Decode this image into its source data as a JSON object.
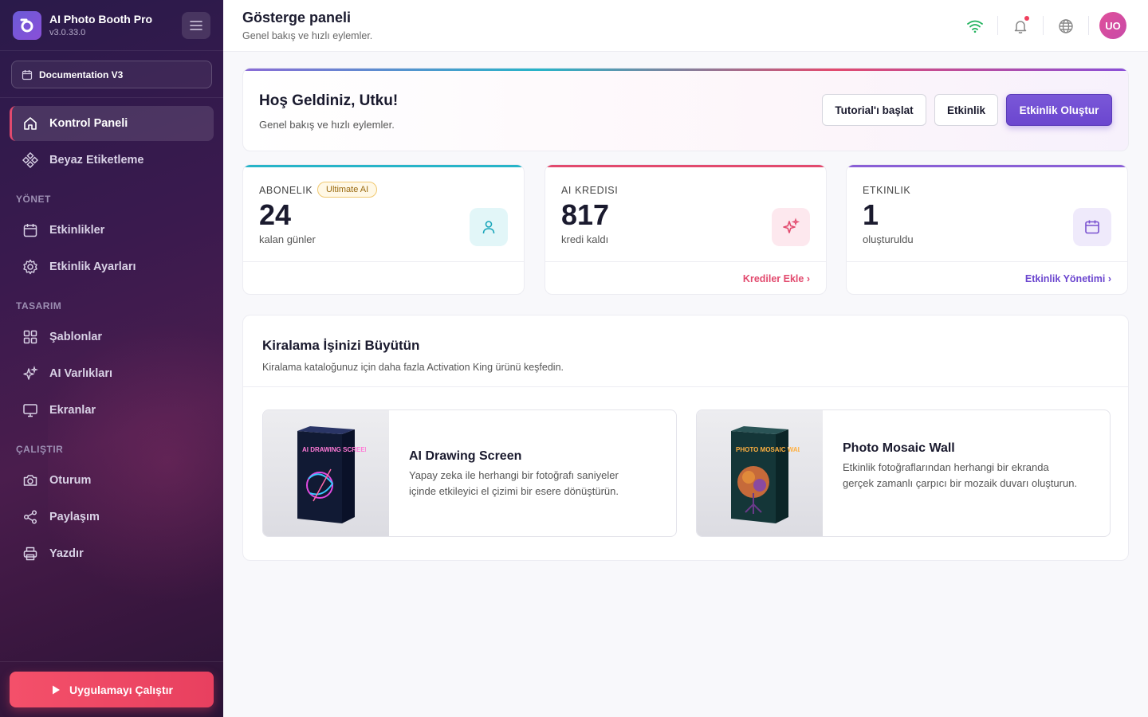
{
  "app": {
    "title": "AI Photo Booth Pro",
    "version": "v3.0.33.0"
  },
  "sidebar": {
    "doc_select": "Documentation V3",
    "items_main": [
      {
        "label": "Kontrol Paneli",
        "icon": "home-icon",
        "active": true
      },
      {
        "label": "Beyaz Etiketleme",
        "icon": "diamond-grid-icon"
      }
    ],
    "section_manage": "YÖNET",
    "items_manage": [
      {
        "label": "Etkinlikler",
        "icon": "calendar-icon"
      },
      {
        "label": "Etkinlik Ayarları",
        "icon": "gear-icon"
      }
    ],
    "section_design": "TASARIM",
    "items_design": [
      {
        "label": "Şablonlar",
        "icon": "grid-icon"
      },
      {
        "label": "AI Varlıkları",
        "icon": "sparkles-icon"
      },
      {
        "label": "Ekranlar",
        "icon": "monitor-icon"
      }
    ],
    "section_run": "ÇALIŞTIR",
    "items_run": [
      {
        "label": "Oturum",
        "icon": "camera-icon"
      },
      {
        "label": "Paylaşım",
        "icon": "share-icon"
      },
      {
        "label": "Yazdır",
        "icon": "printer-icon"
      }
    ],
    "run_button": "Uygulamayı Çalıştır"
  },
  "header": {
    "title": "Gösterge paneli",
    "subtitle": "Genel bakış ve hızlı eylemler.",
    "avatar_initials": "UO"
  },
  "welcome": {
    "title": "Hoş Geldiniz, Utku!",
    "subtitle": "Genel bakış ve hızlı eylemler.",
    "btn_tutorial": "Tutorial'ı başlat",
    "btn_event": "Etkinlik",
    "btn_create": "Etkinlik Oluştur"
  },
  "stats": {
    "subscription": {
      "label": "ABONELIK",
      "badge": "Ultimate AI",
      "value": "24",
      "sub": "kalan günler"
    },
    "credits": {
      "label": "AI KREDISI",
      "value": "817",
      "sub": "kredi kaldı",
      "link": "Krediler Ekle ›"
    },
    "events": {
      "label": "ETKINLIK",
      "value": "1",
      "sub": "oluşturuldu",
      "link": "Etkinlik Yönetimi ›"
    }
  },
  "grow": {
    "title": "Kiralama İşinizi Büyütün",
    "subtitle": "Kiralama kataloğunuz için daha fazla Activation King ürünü keşfedin.",
    "products": [
      {
        "name": "AI Drawing Screen",
        "box_label": "AI DRAWING SCREEN",
        "desc": "Yapay zeka ile herhangi bir fotoğrafı saniyeler içinde etkileyici el çizimi bir esere dönüştürün."
      },
      {
        "name": "Photo Mosaic Wall",
        "box_label": "PHOTO MOSAIC WALL",
        "desc": "Etkinlik fotoğraflarından herhangi bir ekranda gerçek zamanlı çarpıcı bir mozaik duvarı oluşturun."
      }
    ]
  },
  "colors": {
    "accent": "#6b46cf",
    "danger": "#e8405f",
    "teal": "#27b4c8",
    "pink": "#e24a6e",
    "purple": "#8a5fd6"
  }
}
